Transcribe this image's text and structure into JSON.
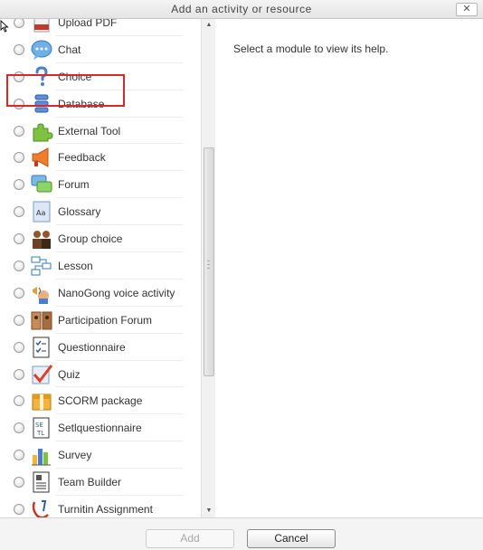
{
  "dialog": {
    "title": "Add an activity or resource",
    "close_label": "✕",
    "help_text": "Select a module to view its help."
  },
  "modules": [
    {
      "label": "Upload PDF",
      "icon": "pdf-icon"
    },
    {
      "label": "Chat",
      "icon": "chat-icon"
    },
    {
      "label": "Choice",
      "icon": "question-mark-icon"
    },
    {
      "label": "Database",
      "icon": "database-icon"
    },
    {
      "label": "External Tool",
      "icon": "puzzle-icon"
    },
    {
      "label": "Feedback",
      "icon": "megaphone-icon"
    },
    {
      "label": "Forum",
      "icon": "forum-icon"
    },
    {
      "label": "Glossary",
      "icon": "glossary-icon"
    },
    {
      "label": "Group choice",
      "icon": "group-icon"
    },
    {
      "label": "Lesson",
      "icon": "lesson-icon"
    },
    {
      "label": "NanoGong voice activity",
      "icon": "voice-icon"
    },
    {
      "label": "Participation Forum",
      "icon": "participation-icon"
    },
    {
      "label": "Questionnaire",
      "icon": "questionnaire-icon"
    },
    {
      "label": "Quiz",
      "icon": "quiz-icon"
    },
    {
      "label": "SCORM package",
      "icon": "scorm-icon"
    },
    {
      "label": "Setlquestionnaire",
      "icon": "setl-icon"
    },
    {
      "label": "Survey",
      "icon": "survey-icon"
    },
    {
      "label": "Team Builder",
      "icon": "team-builder-icon"
    },
    {
      "label": "Turnitin Assignment",
      "icon": "turnitin-icon"
    }
  ],
  "footer": {
    "add_label": "Add",
    "cancel_label": "Cancel"
  },
  "colors": {
    "highlight": "#d8282c"
  }
}
